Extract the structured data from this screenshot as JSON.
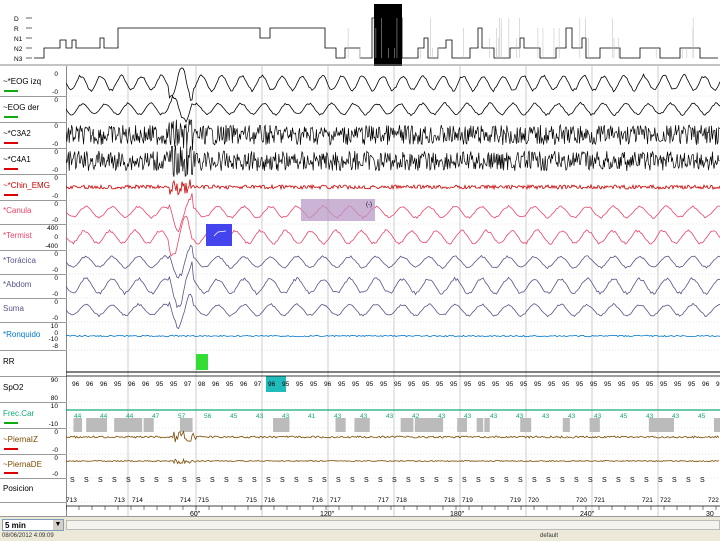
{
  "hypnogram": {
    "stages": [
      "D",
      "R",
      "N1",
      "N2",
      "N3"
    ]
  },
  "channels": [
    {
      "id": "eog-left",
      "label": "~*EOG izq",
      "color": "#000",
      "bar": "#1a1",
      "scale": [
        "0",
        "-0"
      ]
    },
    {
      "id": "eog-right",
      "label": "~EOG der",
      "color": "#000",
      "bar": "#1a1",
      "scale": [
        "0"
      ]
    },
    {
      "id": "c3a2",
      "label": "~*C3A2",
      "color": "#000",
      "bar": "#d00",
      "scale": [
        "0",
        "-0"
      ]
    },
    {
      "id": "c4a1",
      "label": "~*C4A1",
      "color": "#000",
      "bar": "#d00",
      "scale": [
        "0",
        "-0"
      ]
    },
    {
      "id": "chin-emg",
      "label": "~*Chin_EMG",
      "color": "#c00",
      "bar": "#d00",
      "scale": [
        "0",
        "-0"
      ]
    },
    {
      "id": "canula",
      "label": "*Canula",
      "color": "#e46",
      "bar": "",
      "scale": [
        "0",
        "-0"
      ]
    },
    {
      "id": "termist",
      "label": "*Termist",
      "color": "#e46",
      "bar": "",
      "scale": [
        "400",
        "0",
        "-400"
      ]
    },
    {
      "id": "toracica",
      "label": "*Torácica",
      "color": "#558",
      "bar": "",
      "scale": [
        "0",
        "-0"
      ]
    },
    {
      "id": "abdom",
      "label": "*Abdom",
      "color": "#558",
      "bar": "",
      "scale": [
        "0",
        "-0"
      ]
    },
    {
      "id": "suma",
      "label": "Suma",
      "color": "#558",
      "bar": "",
      "scale": [
        "0",
        "-0"
      ]
    },
    {
      "id": "ronquido",
      "label": "*Ronquido",
      "color": "#07c",
      "bar": "",
      "scale": [
        "10",
        "0",
        "-10",
        "-8"
      ]
    },
    {
      "id": "rr",
      "label": "RR",
      "color": "#000",
      "bar": "",
      "scale": []
    },
    {
      "id": "spo2",
      "label": "SpO2",
      "color": "#000",
      "bar": "",
      "scale": [
        "90",
        "80"
      ]
    },
    {
      "id": "frec-car",
      "label": "Frec.Car",
      "color": "#1a7",
      "bar": "#1a1",
      "scale": [
        "10",
        "-10"
      ]
    },
    {
      "id": "pierna-iz",
      "label": "~PiernaIZ",
      "color": "#7a4a00",
      "bar": "#d00",
      "scale": [
        "0",
        "-0"
      ]
    },
    {
      "id": "pierna-de",
      "label": "~PiernaDE",
      "color": "#7a4a00",
      "bar": "#d00",
      "scale": [
        "0",
        "-0"
      ]
    },
    {
      "id": "posicion",
      "label": "Posicion",
      "color": "#000",
      "bar": "",
      "scale": []
    }
  ],
  "spo2_values": [
    "96",
    "96",
    "96",
    "95",
    "96",
    "96",
    "95",
    "95",
    "97",
    "98",
    "96",
    "95",
    "96",
    "97",
    "96",
    "95",
    "95",
    "95",
    "96",
    "95",
    "95",
    "95",
    "95",
    "95",
    "95",
    "95",
    "95",
    "95",
    "95",
    "95",
    "95",
    "95",
    "95",
    "95",
    "95",
    "95",
    "95",
    "95",
    "95",
    "95",
    "95",
    "95",
    "95",
    "95",
    "95",
    "96",
    "96"
  ],
  "heart_rate_values": [
    "44",
    "44",
    "44",
    "47",
    "57",
    "56",
    "45",
    "43",
    "43",
    "41",
    "43",
    "43",
    "43",
    "42",
    "43",
    "43",
    "43",
    "43",
    "43",
    "43",
    "43",
    "45",
    "43",
    "43",
    "45"
  ],
  "epochs": [
    "713",
    "713",
    "714",
    "714",
    "715",
    "715",
    "716",
    "716",
    "717",
    "717",
    "718",
    "718",
    "719",
    "719",
    "720",
    "720",
    "721",
    "721",
    "722",
    "722"
  ],
  "time_axis": [
    "60\"",
    "120\"",
    "180\"",
    "240\"",
    "30"
  ],
  "bottom": {
    "span": "5 min",
    "date": "08/06/2012 4:09:09",
    "status": "default"
  },
  "markers": [
    {
      "type": "event",
      "label": "(-)"
    }
  ],
  "colors": {
    "apnea_box": "#b89ac7",
    "hypopnea_box": "#4444ee",
    "arousal": "#33dd33",
    "desat": "#22bbbb"
  }
}
